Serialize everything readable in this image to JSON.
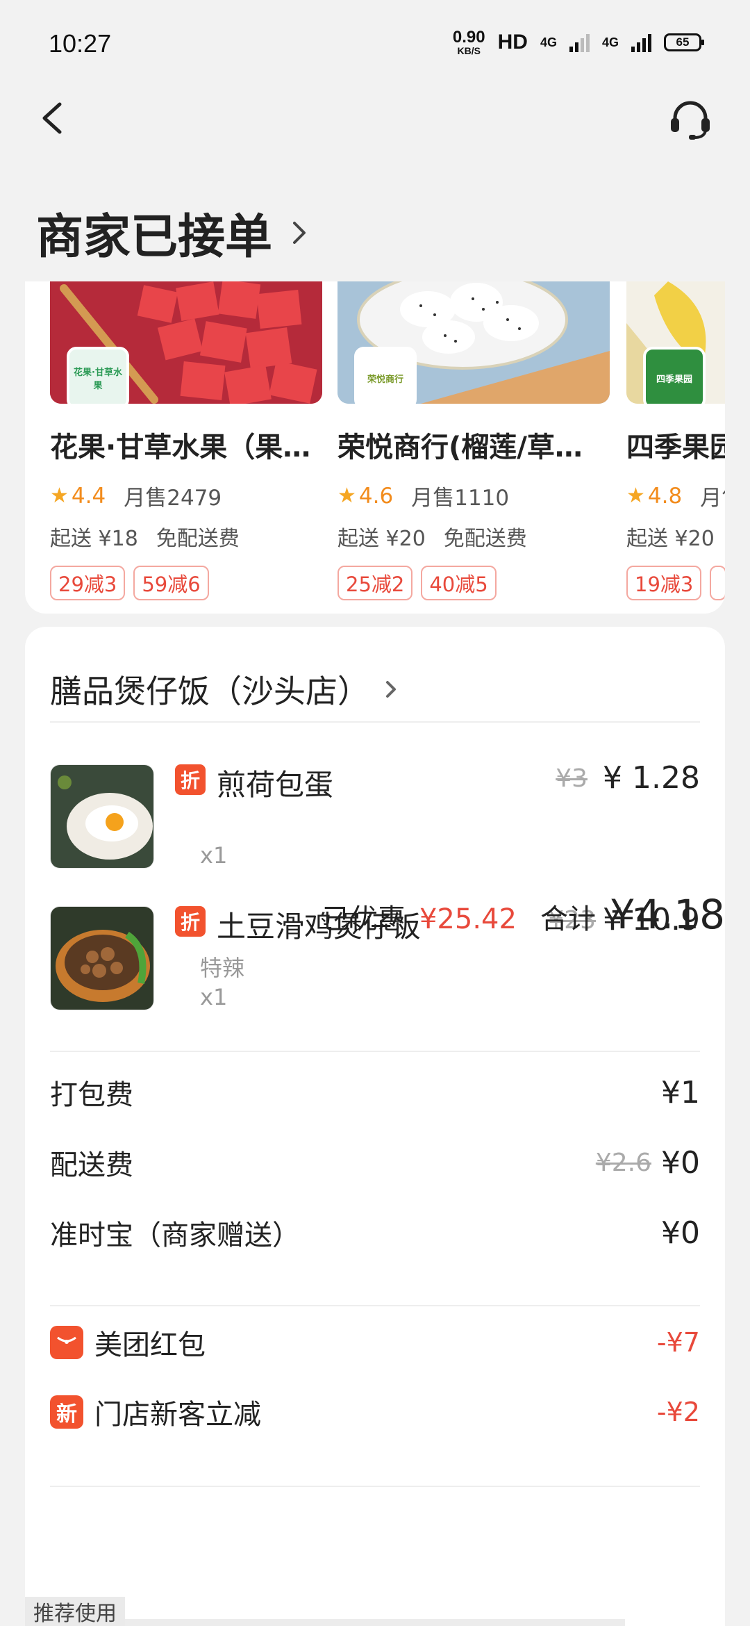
{
  "status_bar": {
    "time": "10:27",
    "net_speed_value": "0.90",
    "net_speed_unit": "KB/S",
    "hd": "HD",
    "net_type_1": "4G",
    "net_type_2": "4G",
    "battery": "65"
  },
  "header": {
    "title": "商家已接单"
  },
  "recommend": {
    "shops": [
      {
        "name": "花果·甘草水果（果…",
        "rating": "4.4",
        "monthly_sales": "月售2479",
        "min_order": "起送 ¥18",
        "delivery": "免配送费",
        "tags": [
          "29减3",
          "59减6"
        ],
        "logo_text": "花果·甘草水果"
      },
      {
        "name": "荣悦商行(榴莲/草…",
        "rating": "4.6",
        "monthly_sales": "月售1110",
        "min_order": "起送 ¥20",
        "delivery": "免配送费",
        "tags": [
          "25减2",
          "40减5"
        ],
        "logo_text": "荣悦商行"
      },
      {
        "name": "四季果园",
        "rating": "4.8",
        "monthly_sales": "月售",
        "min_order": "起送 ¥20",
        "delivery": "",
        "tags": [
          "19减3",
          ""
        ],
        "logo_text": "四季果园"
      }
    ],
    "bottom_tab": "推荐使用"
  },
  "order": {
    "store_name": "膳品煲仔饭（沙头店）",
    "items": [
      {
        "badge": "折",
        "name": "煎荷包蛋",
        "spec": "",
        "qty": "x1",
        "orig_price": "¥3",
        "price": "¥ 1.28"
      },
      {
        "badge": "折",
        "name": "土豆滑鸡煲仔饭",
        "spec": "特辣",
        "qty": "x1",
        "orig_price": "¥23",
        "price": "¥ 10.9"
      }
    ],
    "fees": [
      {
        "label": "打包费",
        "orig": "",
        "value": "¥1"
      },
      {
        "label": "配送费",
        "orig": "¥2.6",
        "value": "¥0"
      },
      {
        "label": "准时宝（商家赠送）",
        "orig": "",
        "value": "¥0"
      }
    ],
    "discounts": [
      {
        "icon": "",
        "label": "美团红包",
        "value": "-¥7"
      },
      {
        "icon": "新",
        "label": "门店新客立减",
        "value": "-¥2"
      }
    ],
    "summary": {
      "saved_label": "已优惠",
      "saved_value": "¥25.42",
      "total_label": "合计",
      "total_value": "¥4.18"
    }
  },
  "colors": {
    "accent_red": "#e8493b",
    "badge_orange": "#f2522e",
    "star": "#f5a623"
  }
}
